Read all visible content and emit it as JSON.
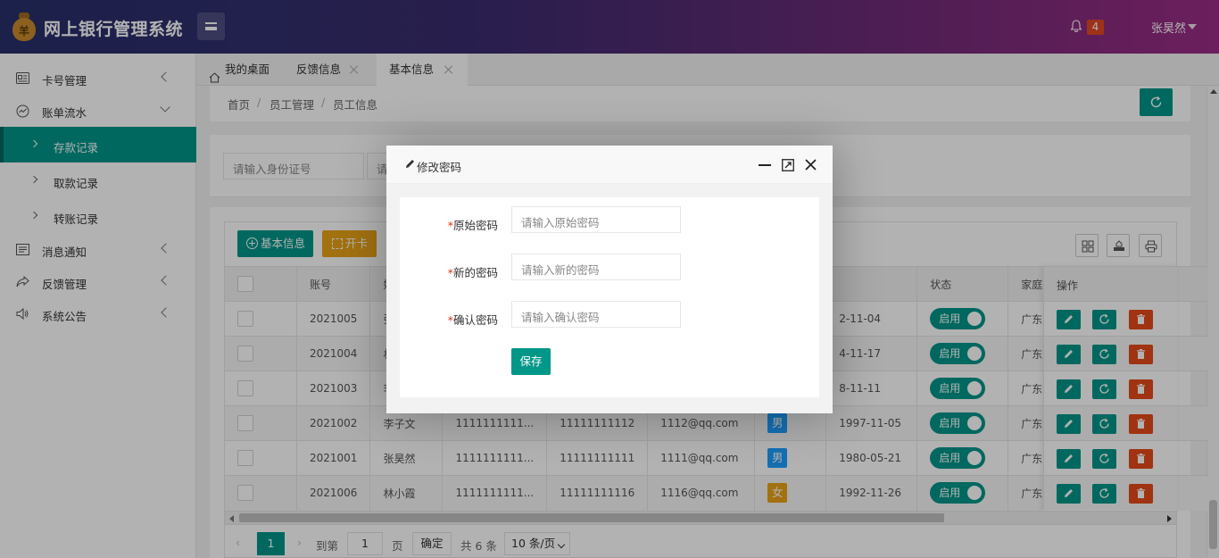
{
  "header": {
    "app_title": "网上银行管理系统",
    "logo_glyph": "羊",
    "notification_count": "4",
    "user_name": "张昊然"
  },
  "sidebar": {
    "items": [
      {
        "label": "卡号管理",
        "icon": "card-icon"
      },
      {
        "label": "账单流水",
        "icon": "chart-icon"
      },
      {
        "label": "消息通知",
        "icon": "message-icon"
      },
      {
        "label": "反馈管理",
        "icon": "share-icon"
      },
      {
        "label": "系统公告",
        "icon": "speaker-icon"
      }
    ],
    "sub_items": [
      {
        "label": "存款记录"
      },
      {
        "label": "取款记录"
      },
      {
        "label": "转账记录"
      }
    ]
  },
  "tabs": [
    {
      "label": "我的桌面"
    },
    {
      "label": "反馈信息"
    },
    {
      "label": "基本信息"
    }
  ],
  "breadcrumb": [
    "首页",
    "员工管理",
    "员工信息"
  ],
  "breadcrumb_sep": "/",
  "search": {
    "id_placeholder": "请输入身份证号",
    "second_placeholder": "请"
  },
  "toolbar": {
    "add_label": "基本信息",
    "open_label": "开卡"
  },
  "table": {
    "headers": [
      "账号",
      "姓",
      "",
      "",
      "",
      "",
      "",
      "状态",
      "家庭籍贯",
      "操作"
    ],
    "rows": [
      {
        "account": "2021005",
        "name": "张",
        "c3": "",
        "c4": "",
        "c5": "",
        "c6": "",
        "date": "2-11-04",
        "status": "启用",
        "hometown": "广东深圳"
      },
      {
        "account": "2021004",
        "name": "林",
        "c3": "",
        "c4": "",
        "c5": "",
        "c6": "",
        "date": "4-11-17",
        "status": "启用",
        "hometown": "广东深圳"
      },
      {
        "account": "2021003",
        "name": "李",
        "c3": "",
        "c4": "",
        "c5": "",
        "c6": "",
        "date": "8-11-11",
        "status": "启用",
        "hometown": "广东深圳"
      },
      {
        "account": "2021002",
        "name": "李子文",
        "c3": "1111111111...",
        "c4": "11111111112",
        "c5": "1112@qq.com",
        "c6": "男",
        "date": "1997-11-05",
        "status": "启用",
        "hometown": "广东深圳"
      },
      {
        "account": "2021001",
        "name": "张昊然",
        "c3": "1111111111...",
        "c4": "11111111111",
        "c5": "1111@qq.com",
        "c6": "男",
        "date": "1980-05-21",
        "status": "启用",
        "hometown": "广东深圳"
      },
      {
        "account": "2021006",
        "name": "林小霞",
        "c3": "1111111111...",
        "c4": "11111111116",
        "c5": "1116@qq.com",
        "c6": "女",
        "date": "1992-11-26",
        "status": "启用",
        "hometown": "广东深圳"
      }
    ]
  },
  "pagination": {
    "current_page": "1",
    "goto_label": "到第",
    "page_input": "1",
    "page_suffix": "页",
    "confirm_label": "确定",
    "total_label": "共 6 条",
    "page_size": "10 条/页"
  },
  "colors": {
    "primary": "#009688",
    "warn": "#e8a317",
    "danger": "#e64a19",
    "male": "#1e9fff",
    "female": "#e8a317"
  },
  "dialog": {
    "title": "修改密码",
    "fields": [
      {
        "label": "原始密码",
        "required_mark": "*",
        "placeholder": "请输入原始密码"
      },
      {
        "label": "新的密码",
        "required_mark": "*",
        "placeholder": "请输入新的密码"
      },
      {
        "label": "确认密码",
        "required_mark": "*",
        "placeholder": "请输入确认密码"
      }
    ],
    "save_label": "保存"
  }
}
